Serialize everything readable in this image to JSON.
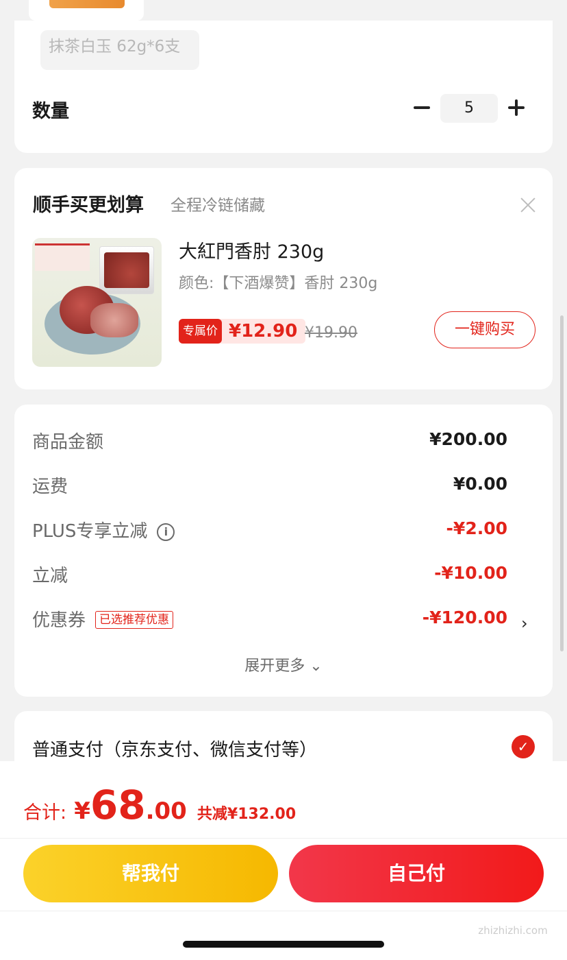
{
  "product_spec": {
    "selected": "抹茶白玉 62g*6支"
  },
  "quantity": {
    "label": "数量",
    "value": "5"
  },
  "upsell": {
    "title": "顺手买更划算",
    "subtitle": "全程冷链储藏",
    "product": {
      "name": "大紅門香肘 230g",
      "variant": "颜色:【下酒爆赞】香肘 230g",
      "tag_label": "专属价",
      "price": "¥12.90",
      "original_price": "¥19.90",
      "buy_label": "一键购买"
    }
  },
  "summary": {
    "rows": [
      {
        "label": "商品金额",
        "value": "¥200.00"
      },
      {
        "label": "运费",
        "value": "¥0.00"
      },
      {
        "label": "PLUS专享立减",
        "value": "-¥2.00"
      },
      {
        "label": "立减",
        "value": "-¥10.00"
      },
      {
        "label": "优惠券",
        "badge": "已选推荐优惠",
        "value": "-¥120.00"
      }
    ],
    "expand_label": "展开更多 ⌄"
  },
  "payment": {
    "label": "普通支付（京东支付、微信支付等）",
    "selected": true
  },
  "footer": {
    "total_label": "合计:",
    "total_yen": "¥",
    "total_int": "68",
    "total_dec": ".00",
    "total_saved": "共减¥132.00",
    "help_pay_label": "帮我付",
    "self_pay_label": "自己付"
  },
  "watermark": "zhizhizhi.com",
  "colors": {
    "accent": "#e2231a",
    "help_button": "#fbc71a",
    "background": "#f2f2f2"
  }
}
